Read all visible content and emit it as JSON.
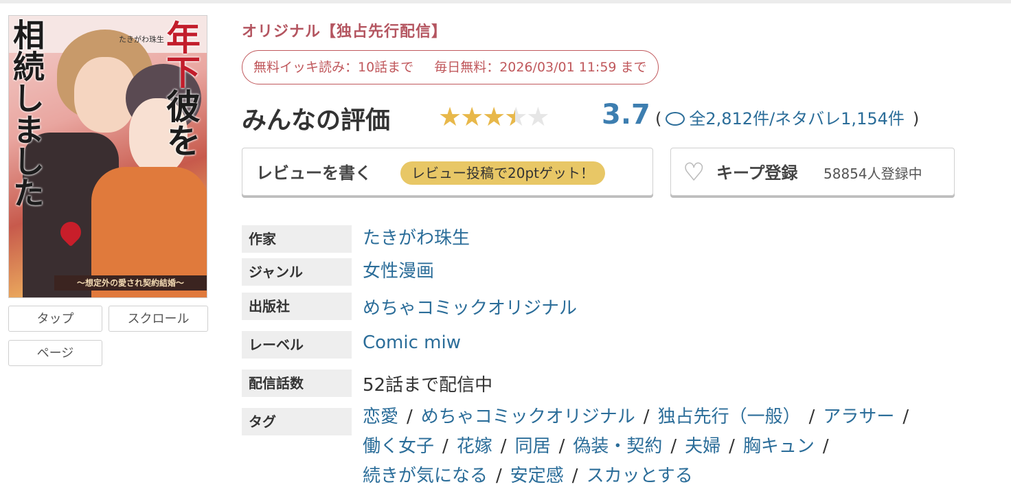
{
  "cover": {
    "title_left": "相続しました",
    "title_right_red": "年下",
    "title_right": "彼を",
    "author": "たきがわ珠生",
    "subtitle": "〜想定外の愛され契約結婚〜"
  },
  "view_buttons": {
    "tap": "タップ",
    "scroll": "スクロール",
    "page": "ページ"
  },
  "title_tag": "オリジナル【独占先行配信】",
  "free": {
    "ikki": "無料イッキ読み：10話まで",
    "daily": "毎日無料：2026/03/01 11:59 まで"
  },
  "rating": {
    "title": "みんなの評価",
    "score": "3.7",
    "score_value": 3.7,
    "max_stars": 5,
    "star_color": "#e8b84a",
    "open_paren": "(",
    "close_paren": ")",
    "counts": "全2,812件/ネタバレ1,154件"
  },
  "review": {
    "label": "レビューを書く",
    "promo": "レビュー投稿で20ptゲット！"
  },
  "keep": {
    "label": "キープ登録",
    "count": "58854人登録中"
  },
  "info": {
    "author_label": "作家",
    "author": "たきがわ珠生",
    "genre_label": "ジャンル",
    "genre": "女性漫画",
    "publisher_label": "出版社",
    "publisher": "めちゃコミックオリジナル",
    "label_label": "レーベル",
    "label": "Comic miw",
    "episodes_label": "配信話数",
    "episodes": "52話まで配信中",
    "tags_label": "タグ",
    "tags": [
      "恋愛",
      "めちゃコミックオリジナル",
      "独占先行（一般）",
      "アラサー",
      "働く女子",
      "花嫁",
      "同居",
      "偽装・契約",
      "夫婦",
      "胸キュン",
      "続きが気になる",
      "安定感",
      "スカッとする"
    ]
  },
  "colors": {
    "accent_red": "#c0585c",
    "link_blue": "#2b6d99",
    "score_blue": "#3d7eb0",
    "promo_yellow": "#e8c766"
  }
}
